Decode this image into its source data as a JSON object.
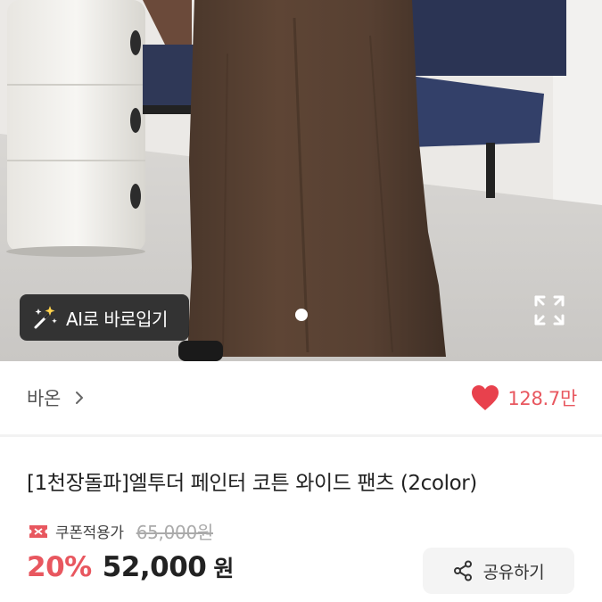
{
  "hero": {
    "ai_button_label": "AI로 바로입기",
    "ai_icon": "magic-wand-icon",
    "expand_icon": "expand-icon",
    "current_slide": 1,
    "total_slides": 1
  },
  "brand": {
    "name": "바온",
    "chevron_icon": "chevron-right-icon"
  },
  "likes": {
    "count": "128.7만",
    "icon": "heart-icon",
    "color": "#e8575f"
  },
  "product": {
    "title": "[1천장돌파]엘투더 페인터 코튼 와이드 팬츠 (2color)",
    "coupon_label": "쿠폰적용가",
    "coupon_icon": "coupon-icon",
    "original_price": "65,000원",
    "discount": "20%",
    "sale_price": "52,000",
    "currency": "원"
  },
  "share": {
    "label": "공유하기",
    "icon": "share-icon"
  },
  "colors": {
    "accent": "#e8575f",
    "text": "#222222",
    "muted": "#aaaaaa"
  }
}
